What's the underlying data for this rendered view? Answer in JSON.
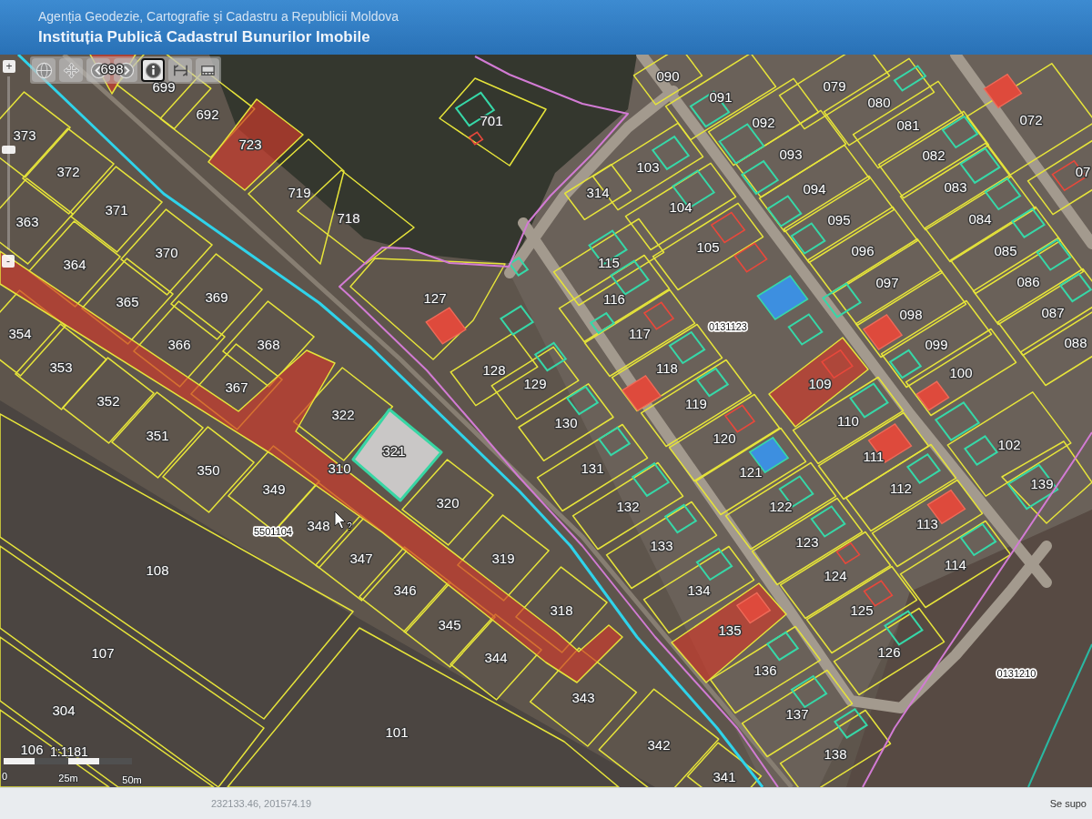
{
  "header": {
    "agency": "Agenția Geodezie, Cartografie și Cadastru a Republicii Moldova",
    "institution": "Instituția Publică Cadastrul Bunurilor Imobile"
  },
  "toolbar": {
    "tools": [
      {
        "kind": "globe",
        "selected": false
      },
      {
        "kind": "pan",
        "selected": false
      },
      {
        "kind": "back",
        "selected": false
      },
      {
        "kind": "forward",
        "selected": false
      },
      {
        "kind": "info",
        "selected": true
      },
      {
        "kind": "measure-line",
        "selected": false
      },
      {
        "kind": "measure-area",
        "selected": false
      }
    ]
  },
  "zoom": {
    "in_label": "+",
    "out_label": "-",
    "level": 0.58
  },
  "map": {
    "parcels": [
      {
        "number": "698",
        "kind": "highlighted",
        "selected": false
      },
      {
        "number": "090",
        "kind": "normal",
        "selected": false
      },
      {
        "number": "699",
        "kind": "normal",
        "selected": false
      },
      {
        "number": "079",
        "kind": "normal",
        "selected": false
      },
      {
        "number": "091",
        "kind": "normal",
        "selected": false
      },
      {
        "number": "080",
        "kind": "normal",
        "selected": false
      },
      {
        "number": "692",
        "kind": "normal",
        "selected": false
      },
      {
        "number": "701",
        "kind": "normal",
        "selected": false
      },
      {
        "number": "092",
        "kind": "normal",
        "selected": false
      },
      {
        "number": "081",
        "kind": "normal",
        "selected": false
      },
      {
        "number": "072",
        "kind": "normal",
        "selected": false
      },
      {
        "number": "373",
        "kind": "normal",
        "selected": false
      },
      {
        "number": "723",
        "kind": "highlighted",
        "selected": false
      },
      {
        "number": "093",
        "kind": "normal",
        "selected": false
      },
      {
        "number": "082",
        "kind": "normal",
        "selected": false
      },
      {
        "number": "372",
        "kind": "normal",
        "selected": false
      },
      {
        "number": "103",
        "kind": "normal",
        "selected": false
      },
      {
        "number": "07",
        "kind": "normal",
        "selected": false
      },
      {
        "number": "719",
        "kind": "normal",
        "selected": false
      },
      {
        "number": "314",
        "kind": "normal",
        "selected": false
      },
      {
        "number": "094",
        "kind": "normal",
        "selected": false
      },
      {
        "number": "083",
        "kind": "normal",
        "selected": false
      },
      {
        "number": "371",
        "kind": "normal",
        "selected": false
      },
      {
        "number": "104",
        "kind": "normal",
        "selected": false
      },
      {
        "number": "363",
        "kind": "normal",
        "selected": false
      },
      {
        "number": "718",
        "kind": "normal",
        "selected": false
      },
      {
        "number": "095",
        "kind": "normal",
        "selected": false
      },
      {
        "number": "084",
        "kind": "normal",
        "selected": false
      },
      {
        "number": "370",
        "kind": "normal",
        "selected": false
      },
      {
        "number": "105",
        "kind": "normal",
        "selected": false
      },
      {
        "number": "096",
        "kind": "normal",
        "selected": false
      },
      {
        "number": "085",
        "kind": "normal",
        "selected": false
      },
      {
        "number": "364",
        "kind": "normal",
        "selected": false
      },
      {
        "number": "115",
        "kind": "normal",
        "selected": false
      },
      {
        "number": "097",
        "kind": "normal",
        "selected": false
      },
      {
        "number": "086",
        "kind": "normal",
        "selected": false
      },
      {
        "number": "365",
        "kind": "normal",
        "selected": false
      },
      {
        "number": "369",
        "kind": "normal",
        "selected": false
      },
      {
        "number": "127",
        "kind": "normal",
        "selected": false
      },
      {
        "number": "116",
        "kind": "normal",
        "selected": false
      },
      {
        "number": "098",
        "kind": "normal",
        "selected": false
      },
      {
        "number": "087",
        "kind": "normal",
        "selected": false
      },
      {
        "number": "354",
        "kind": "normal",
        "selected": false
      },
      {
        "number": "117",
        "kind": "normal",
        "selected": false
      },
      {
        "number": "366",
        "kind": "normal",
        "selected": false
      },
      {
        "number": "368",
        "kind": "normal",
        "selected": false
      },
      {
        "number": "099",
        "kind": "normal",
        "selected": false
      },
      {
        "number": "088",
        "kind": "normal",
        "selected": false
      },
      {
        "number": "353",
        "kind": "normal",
        "selected": false
      },
      {
        "number": "128",
        "kind": "normal",
        "selected": false
      },
      {
        "number": "118",
        "kind": "normal",
        "selected": false
      },
      {
        "number": "100",
        "kind": "normal",
        "selected": false
      },
      {
        "number": "367",
        "kind": "normal",
        "selected": false
      },
      {
        "number": "129",
        "kind": "normal",
        "selected": false
      },
      {
        "number": "109",
        "kind": "highlighted",
        "selected": false
      },
      {
        "number": "352",
        "kind": "normal",
        "selected": false
      },
      {
        "number": "119",
        "kind": "normal",
        "selected": false
      },
      {
        "number": "322",
        "kind": "normal",
        "selected": false
      },
      {
        "number": "130",
        "kind": "normal",
        "selected": false
      },
      {
        "number": "110",
        "kind": "normal",
        "selected": false
      },
      {
        "number": "351",
        "kind": "normal",
        "selected": false
      },
      {
        "number": "120",
        "kind": "normal",
        "selected": false
      },
      {
        "number": "321",
        "kind": "normal",
        "selected": true
      },
      {
        "number": "102",
        "kind": "normal",
        "selected": false
      },
      {
        "number": "111",
        "kind": "normal",
        "selected": false
      },
      {
        "number": "350",
        "kind": "normal",
        "selected": false
      },
      {
        "number": "310",
        "kind": "highlighted",
        "selected": false
      },
      {
        "number": "131",
        "kind": "normal",
        "selected": false
      },
      {
        "number": "121",
        "kind": "normal",
        "selected": false
      },
      {
        "number": "349",
        "kind": "normal",
        "selected": false
      },
      {
        "number": "112",
        "kind": "normal",
        "selected": false
      },
      {
        "number": "139",
        "kind": "normal",
        "selected": false
      },
      {
        "number": "320",
        "kind": "normal",
        "selected": false
      },
      {
        "number": "132",
        "kind": "normal",
        "selected": false
      },
      {
        "number": "122",
        "kind": "normal",
        "selected": false
      },
      {
        "number": "348",
        "kind": "normal",
        "selected": false
      },
      {
        "number": "113",
        "kind": "normal",
        "selected": false
      },
      {
        "number": "133",
        "kind": "normal",
        "selected": false
      },
      {
        "number": "123",
        "kind": "normal",
        "selected": false
      },
      {
        "number": "347",
        "kind": "normal",
        "selected": false
      },
      {
        "number": "319",
        "kind": "normal",
        "selected": false
      },
      {
        "number": "108",
        "kind": "normal",
        "selected": false
      },
      {
        "number": "114",
        "kind": "normal",
        "selected": false
      },
      {
        "number": "124",
        "kind": "normal",
        "selected": false
      },
      {
        "number": "346",
        "kind": "normal",
        "selected": false
      },
      {
        "number": "134",
        "kind": "normal",
        "selected": false
      },
      {
        "number": "318",
        "kind": "normal",
        "selected": false
      },
      {
        "number": "125",
        "kind": "normal",
        "selected": false
      },
      {
        "number": "345",
        "kind": "normal",
        "selected": false
      },
      {
        "number": "135",
        "kind": "highlighted",
        "selected": false
      },
      {
        "number": "107",
        "kind": "normal",
        "selected": false
      },
      {
        "number": "344",
        "kind": "normal",
        "selected": false
      },
      {
        "number": "126",
        "kind": "normal",
        "selected": false
      },
      {
        "number": "136",
        "kind": "normal",
        "selected": false
      },
      {
        "number": "343",
        "kind": "normal",
        "selected": false
      },
      {
        "number": "304",
        "kind": "normal",
        "selected": false
      },
      {
        "number": "137",
        "kind": "normal",
        "selected": false
      },
      {
        "number": "101",
        "kind": "normal",
        "selected": false
      },
      {
        "number": "106",
        "kind": "normal",
        "selected": false
      },
      {
        "number": "342",
        "kind": "normal",
        "selected": false
      },
      {
        "number": "138",
        "kind": "normal",
        "selected": false
      },
      {
        "number": "341",
        "kind": "normal",
        "selected": false
      }
    ],
    "sector_codes": [
      "0131123",
      "5501104",
      "0131210"
    ],
    "cursor_hint": "?"
  },
  "scale": {
    "ratio": "1:1181",
    "ticks": [
      "0",
      "25m",
      "50m"
    ]
  },
  "status_bar": {
    "coordinates": "232133.46, 201574.19",
    "message": "Se supo"
  }
}
